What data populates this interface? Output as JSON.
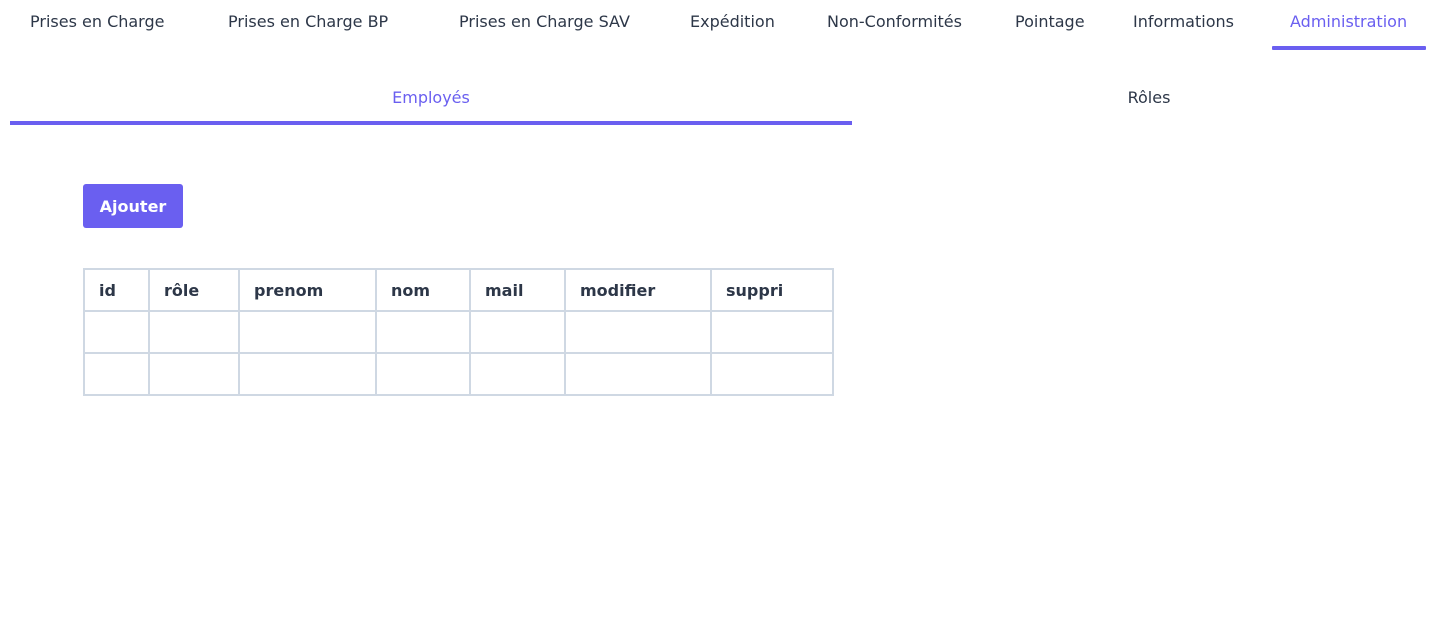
{
  "topnav": {
    "tabs": [
      {
        "label": "Prises en Charge"
      },
      {
        "label": "Prises en Charge BP"
      },
      {
        "label": "Prises en Charge SAV"
      },
      {
        "label": "Expédition"
      },
      {
        "label": "Non-Conformités"
      },
      {
        "label": "Pointage"
      },
      {
        "label": "Informations"
      },
      {
        "label": "Administration"
      }
    ],
    "active": "Administration"
  },
  "subtabs": {
    "tabs": [
      {
        "label": "Employés"
      },
      {
        "label": "Rôles"
      }
    ],
    "active": "Employés"
  },
  "actions": {
    "add_label": "Ajouter"
  },
  "table": {
    "columns": [
      "id",
      "rôle",
      "prenom",
      "nom",
      "mail",
      "modifier",
      "suppri"
    ],
    "rows": [
      [
        "",
        "",
        "",
        "",
        "",
        "",
        ""
      ],
      [
        "",
        "",
        "",
        "",
        "",
        "",
        ""
      ]
    ]
  },
  "colors": {
    "accent": "#6a5ff0",
    "text": "#2d3748",
    "table_border": "#cfd8e3"
  }
}
